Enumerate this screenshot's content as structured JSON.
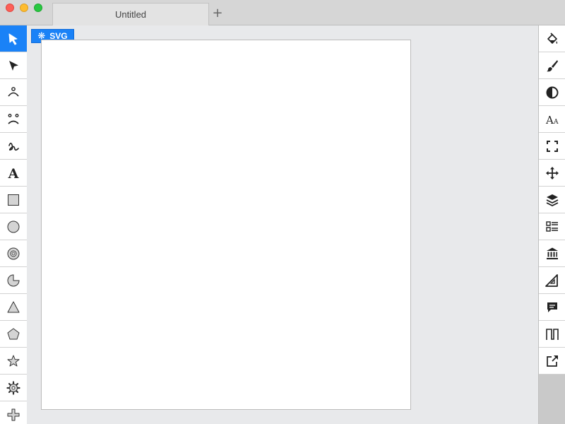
{
  "window": {
    "tab_title": "Untitled",
    "new_tab_symbol": "+"
  },
  "badge": {
    "label": "SVG",
    "icon": "asterisk-icon"
  },
  "left_tools": [
    {
      "name": "select-tool",
      "icon": "arrow-cursor-icon",
      "active": true
    },
    {
      "name": "node-edit-tool",
      "icon": "arrow-pointer-icon"
    },
    {
      "name": "path-tool",
      "icon": "path-node-icon"
    },
    {
      "name": "bezier-tool",
      "icon": "bezier-nodes-icon"
    },
    {
      "name": "freehand-tool",
      "icon": "squiggle-icon"
    },
    {
      "name": "text-tool",
      "icon": "text-a-icon"
    },
    {
      "name": "rectangle-tool",
      "icon": "rectangle-icon"
    },
    {
      "name": "ellipse-tool",
      "icon": "circle-icon"
    },
    {
      "name": "ring-tool",
      "icon": "ring-icon"
    },
    {
      "name": "pie-tool",
      "icon": "pie-icon"
    },
    {
      "name": "triangle-tool",
      "icon": "triangle-icon"
    },
    {
      "name": "polygon-tool",
      "icon": "pentagon-icon"
    },
    {
      "name": "star-tool",
      "icon": "star-icon"
    },
    {
      "name": "gear-tool",
      "icon": "gear-icon"
    },
    {
      "name": "cross-tool",
      "icon": "cross-icon"
    }
  ],
  "right_tools": [
    {
      "name": "fill-tool",
      "icon": "paint-bucket-icon"
    },
    {
      "name": "stroke-tool",
      "icon": "brush-icon"
    },
    {
      "name": "opacity-tool",
      "icon": "contrast-icon"
    },
    {
      "name": "typography-tool",
      "icon": "font-size-icon"
    },
    {
      "name": "fullscreen-tool",
      "icon": "fullscreen-icon"
    },
    {
      "name": "transform-tool",
      "icon": "move-arrows-icon"
    },
    {
      "name": "layers-tool",
      "icon": "layers-icon"
    },
    {
      "name": "list-tool",
      "icon": "list-icon"
    },
    {
      "name": "library-tool",
      "icon": "bank-icon"
    },
    {
      "name": "measure-tool",
      "icon": "set-square-icon"
    },
    {
      "name": "comments-tool",
      "icon": "comment-icon"
    },
    {
      "name": "waveform-tool",
      "icon": "square-wave-icon"
    },
    {
      "name": "export-tool",
      "icon": "external-link-icon"
    }
  ],
  "colors": {
    "accent": "#1a82f7",
    "toolbar_bg": "#ffffff",
    "workspace_bg": "#e8e9eb",
    "titlebar_bg": "#d6d6d6"
  }
}
